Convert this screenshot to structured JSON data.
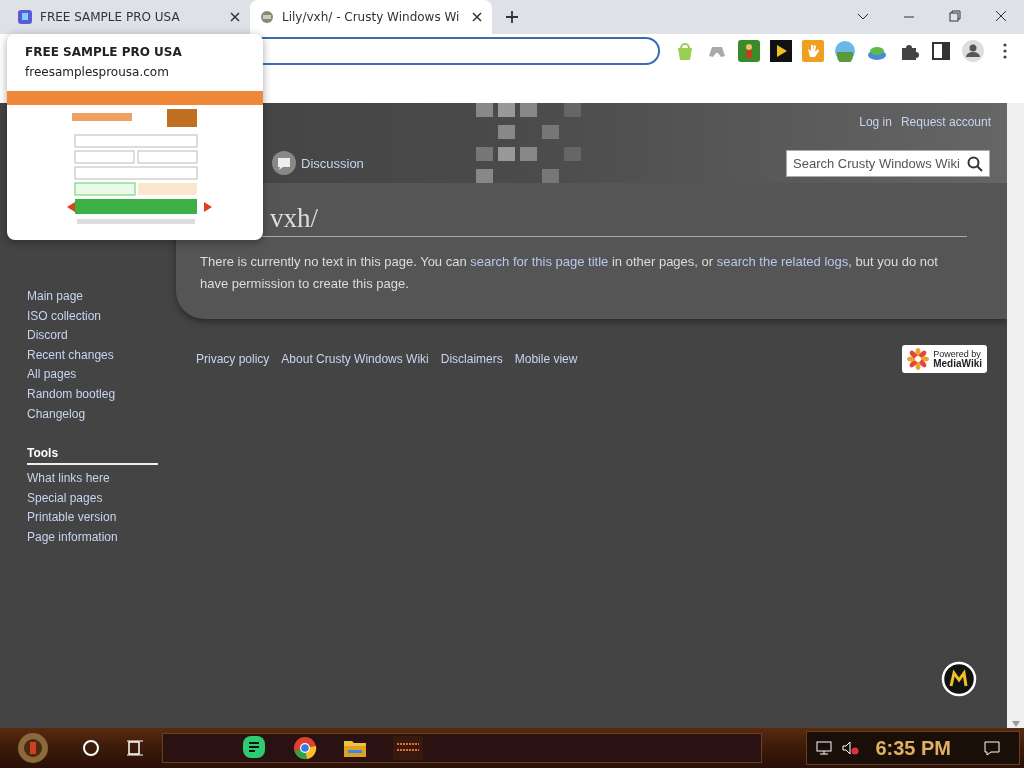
{
  "tabs": [
    {
      "title": "FREE SAMPLE PRO USA",
      "selected": false
    },
    {
      "title": "Lily/vxh/ - Crusty Windows Wi",
      "selected": true
    }
  ],
  "hover_card": {
    "title": "FREE SAMPLE PRO USA",
    "domain": "freesamplesprousa.com"
  },
  "header": {
    "personal": [
      "Log in",
      "Request account"
    ],
    "discussion_tab": "Discussion",
    "search": {
      "placeholder": "Search Crusty Windows Wiki"
    }
  },
  "article": {
    "heading": "vxh/",
    "notice": [
      {
        "kind": "text",
        "text": "There is currently no text in this page. You can "
      },
      {
        "kind": "link",
        "text": "search for this page title"
      },
      {
        "kind": "text",
        "text": " in other pages, or "
      },
      {
        "kind": "link",
        "text": "search the related logs"
      },
      {
        "kind": "text",
        "text": ", but you do not have permission to create this page."
      }
    ]
  },
  "sidebar": {
    "navigation": [
      "Main page",
      "ISO collection",
      "Discord",
      "Recent changes",
      "All pages",
      "Random bootleg",
      "Changelog"
    ],
    "tools_heading": "Tools",
    "tools": [
      "What links here",
      "Special pages",
      "Printable version",
      "Page information"
    ]
  },
  "footer": {
    "links": [
      "Privacy policy",
      "About Crusty Windows Wiki",
      "Disclaimers",
      "Mobile view"
    ],
    "badge": [
      "Powered by",
      "MediaWiki"
    ]
  },
  "taskbar": {
    "clock": "6:35 PM"
  }
}
